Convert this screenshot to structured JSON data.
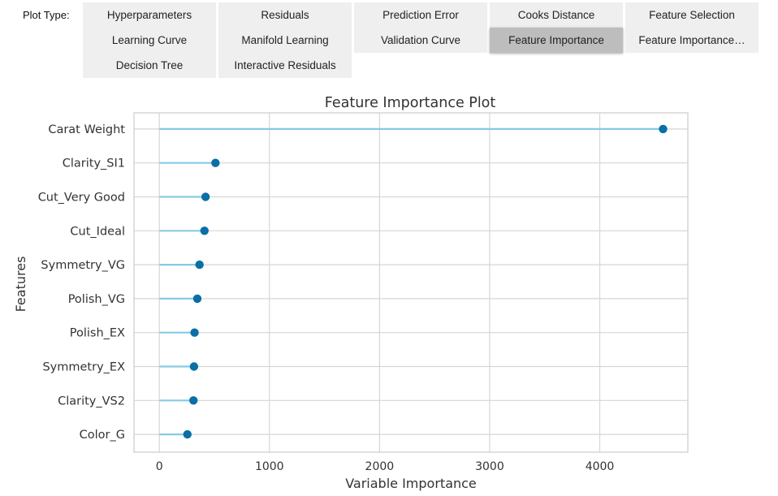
{
  "toolbar": {
    "label": "Plot Type:",
    "buttons": [
      {
        "label": "Hyperparameters",
        "active": false
      },
      {
        "label": "Residuals",
        "active": false
      },
      {
        "label": "Prediction Error",
        "active": false
      },
      {
        "label": "Cooks Distance",
        "active": false
      },
      {
        "label": "Feature Selection",
        "active": false
      },
      {
        "label": "Learning Curve",
        "active": false
      },
      {
        "label": "Manifold Learning",
        "active": false
      },
      {
        "label": "Validation Curve",
        "active": false
      },
      {
        "label": "Feature Importance",
        "active": true
      },
      {
        "label": "Feature Importance…",
        "active": false
      },
      {
        "label": "Decision Tree",
        "active": false
      },
      {
        "label": "Interactive Residuals",
        "active": false
      }
    ]
  },
  "colors": {
    "accent": "#0a6fa6",
    "stem": "#87cae4",
    "grid": "#d6d6d6",
    "frame": "#cfcfcf",
    "active_button": "#bdbdbd",
    "button": "#efefef"
  },
  "chart_data": {
    "type": "lollipop",
    "title": "Feature Importance Plot",
    "xlabel": "Variable Importance",
    "ylabel": "Features",
    "xlim": [
      -230,
      4800
    ],
    "xticks": [
      0,
      1000,
      2000,
      3000,
      4000
    ],
    "xtick_labels": [
      "0",
      "1000",
      "2000",
      "3000",
      "4000"
    ],
    "grid": true,
    "categories": [
      "Carat Weight",
      "Clarity_SI1",
      "Cut_Very Good",
      "Cut_Ideal",
      "Symmetry_VG",
      "Polish_VG",
      "Polish_EX",
      "Symmetry_EX",
      "Clarity_VS2",
      "Color_G"
    ],
    "values": [
      4575,
      510,
      420,
      410,
      365,
      345,
      320,
      315,
      310,
      255
    ]
  }
}
